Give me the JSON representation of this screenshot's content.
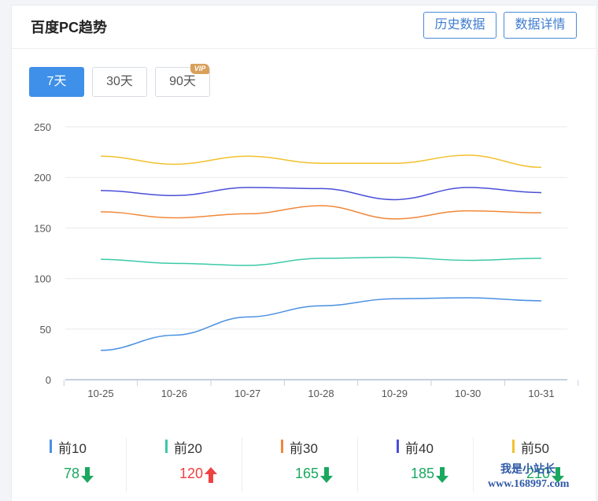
{
  "header": {
    "title": "百度PC趋势",
    "history_btn": "历史数据",
    "detail_btn": "数据详情"
  },
  "ranges": {
    "r7": "7天",
    "r30": "30天",
    "r90": "90天",
    "vip": "VIP"
  },
  "chart_data": {
    "type": "line",
    "categories": [
      "10-25",
      "10-26",
      "10-27",
      "10-28",
      "10-29",
      "10-30",
      "10-31"
    ],
    "ylim": [
      0,
      250
    ],
    "yticks": [
      0,
      50,
      100,
      150,
      200,
      250
    ],
    "grid": true,
    "series": [
      {
        "name": "前10",
        "color": "#4a90e2",
        "values": [
          29,
          44,
          62,
          73,
          80,
          81,
          78
        ]
      },
      {
        "name": "前20",
        "color": "#3cc9a8",
        "values": [
          119,
          115,
          113,
          120,
          121,
          118,
          120
        ]
      },
      {
        "name": "前30",
        "color": "#f0883a",
        "values": [
          166,
          160,
          164,
          172,
          159,
          167,
          165
        ]
      },
      {
        "name": "前40",
        "color": "#4a4fd8",
        "values": [
          187,
          182,
          190,
          189,
          178,
          190,
          185
        ]
      },
      {
        "name": "前50",
        "color": "#f2c12e",
        "values": [
          221,
          213,
          221,
          214,
          214,
          222,
          210
        ]
      }
    ]
  },
  "legend": [
    {
      "name": "前10",
      "value": "78",
      "trend": "down",
      "color": "#4a90e2"
    },
    {
      "name": "前20",
      "value": "120",
      "trend": "up",
      "color": "#3cc9a8"
    },
    {
      "name": "前30",
      "value": "165",
      "trend": "down",
      "color": "#f0883a"
    },
    {
      "name": "前40",
      "value": "185",
      "trend": "down",
      "color": "#4a4fd8"
    },
    {
      "name": "前50",
      "value": "210",
      "trend": "down",
      "color": "#f2c12e"
    }
  ],
  "colors": {
    "up": "#f04040",
    "down": "#1aa85f",
    "accent": "#3f90e8"
  },
  "watermark": {
    "line1": "我是小站长",
    "line2": "www.168997.com"
  }
}
